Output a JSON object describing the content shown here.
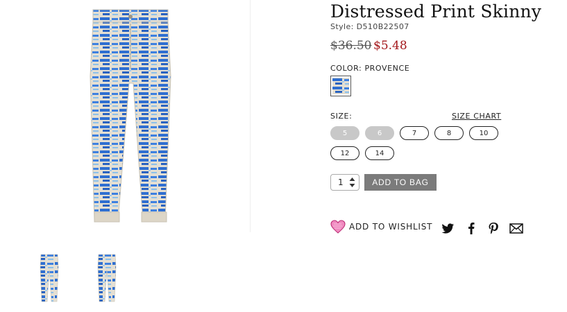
{
  "product": {
    "title": "Distressed Print Skinny",
    "style": "Style: D510B22507",
    "price_original": "$36.50",
    "price_sale": "$5.48"
  },
  "color": {
    "label": "COLOR: PROVENCE"
  },
  "size": {
    "label": "SIZE:",
    "chart_link": "SIZE CHART",
    "options": [
      {
        "label": "5",
        "available": false
      },
      {
        "label": "6",
        "available": false
      },
      {
        "label": "7",
        "available": true
      },
      {
        "label": "8",
        "available": true
      },
      {
        "label": "10",
        "available": true
      },
      {
        "label": "12",
        "available": true
      },
      {
        "label": "14",
        "available": true
      }
    ]
  },
  "cart": {
    "quantity": "1",
    "add_label": "ADD TO BAG"
  },
  "wishlist": {
    "label": "ADD TO WISHLIST"
  },
  "share": [
    "twitter-icon",
    "facebook-icon",
    "pinterest-icon",
    "email-icon"
  ],
  "colors": {
    "sale": "#a3161a",
    "button": "#7b7b7b",
    "print_blue": "#2f6fd1",
    "fabric": "#e2ddd0",
    "heart": "#e8559b"
  }
}
